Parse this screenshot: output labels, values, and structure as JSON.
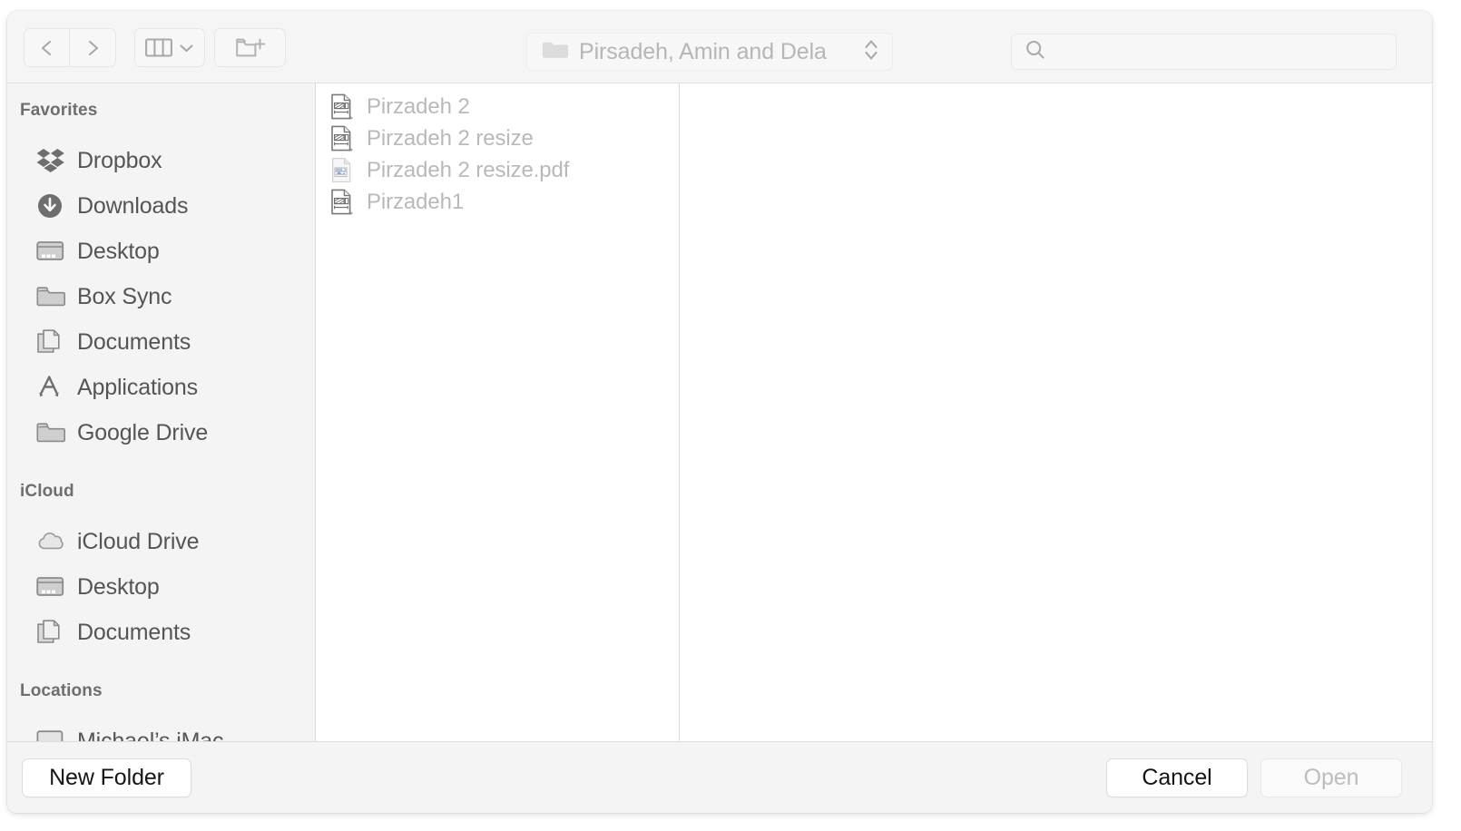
{
  "toolbar": {
    "back_icon": "chevron-left-icon",
    "forward_icon": "chevron-right-icon",
    "view_icon": "column-view-icon",
    "view_chevron_icon": "chevron-down-icon",
    "new_folder_icon": "new-folder-icon",
    "path": {
      "folder_icon": "folder-icon",
      "label": "Pirsadeh, Amin and Dela",
      "stepper_icon": "up-down-chevron-icon"
    },
    "search": {
      "icon": "search-icon",
      "value": "",
      "placeholder": ""
    }
  },
  "sidebar": {
    "sections": [
      {
        "title": "Favorites",
        "items": [
          {
            "label": "Dropbox",
            "icon": "dropbox-icon"
          },
          {
            "label": "Downloads",
            "icon": "downloads-icon"
          },
          {
            "label": "Desktop",
            "icon": "desktop-icon"
          },
          {
            "label": "Box Sync",
            "icon": "folder-icon"
          },
          {
            "label": "Documents",
            "icon": "documents-icon"
          },
          {
            "label": "Applications",
            "icon": "applications-icon"
          },
          {
            "label": "Google Drive",
            "icon": "folder-icon"
          }
        ]
      },
      {
        "title": "iCloud",
        "items": [
          {
            "label": "iCloud Drive",
            "icon": "cloud-icon"
          },
          {
            "label": "Desktop",
            "icon": "desktop-icon"
          },
          {
            "label": "Documents",
            "icon": "documents-icon"
          }
        ]
      },
      {
        "title": "Locations",
        "items": [
          {
            "label": "Michael’s iMac",
            "icon": "imac-icon"
          }
        ]
      }
    ]
  },
  "file_list": {
    "items": [
      {
        "name": "Pirzadeh 2",
        "icon": "drawing-document-icon",
        "enabled": false
      },
      {
        "name": "Pirzadeh 2 resize",
        "icon": "drawing-document-icon",
        "enabled": false
      },
      {
        "name": "Pirzadeh 2 resize.pdf",
        "icon": "pdf-document-icon",
        "enabled": false
      },
      {
        "name": "Pirzadeh1",
        "icon": "drawing-document-icon",
        "enabled": false
      }
    ]
  },
  "footer": {
    "new_folder_label": "New Folder",
    "cancel_label": "Cancel",
    "open_label": "Open",
    "open_enabled": false
  },
  "colors": {
    "toolbar_bg": "#f5f5f5",
    "sidebar_bg": "#f4f4f4",
    "content_bg": "#ffffff",
    "divider": "#dcdcdc",
    "sidebar_text": "#555555",
    "section_header_text": "#6e6e6e",
    "disabled_text": "#b9b9b9",
    "icon_grey": "#a8a8a8"
  }
}
